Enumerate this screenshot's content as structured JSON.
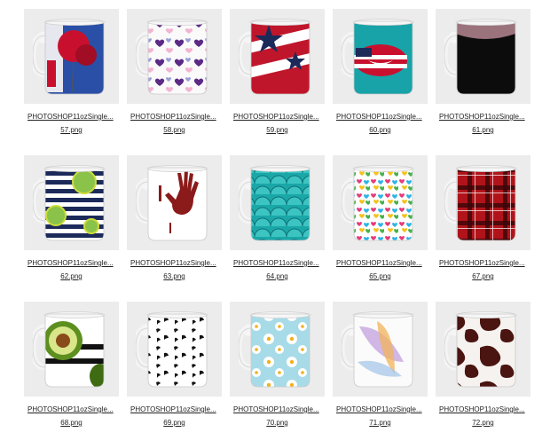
{
  "files": [
    {
      "name": "PHOTOSHOP11ozSingle...",
      "ext": "57.png",
      "design": "balloon-icon"
    },
    {
      "name": "PHOTOSHOP11ozSingle...",
      "ext": "58.png",
      "design": "hearts-icon"
    },
    {
      "name": "PHOTOSHOP11ozSingle...",
      "ext": "59.png",
      "design": "stars-stripes-icon"
    },
    {
      "name": "PHOTOSHOP11ozSingle...",
      "ext": "60.png",
      "design": "flag-lips-icon"
    },
    {
      "name": "PHOTOSHOP11ozSingle...",
      "ext": "61.png",
      "design": "black-sparkle-icon"
    },
    {
      "name": "PHOTOSHOP11ozSingle...",
      "ext": "62.png",
      "design": "lime-stripes-icon"
    },
    {
      "name": "PHOTOSHOP11ozSingle...",
      "ext": "63.png",
      "design": "handprint-icon"
    },
    {
      "name": "PHOTOSHOP11ozSingle...",
      "ext": "64.png",
      "design": "mermaid-scales-icon"
    },
    {
      "name": "PHOTOSHOP11ozSingle...",
      "ext": "65.png",
      "design": "rainbow-hearts-icon"
    },
    {
      "name": "PHOTOSHOP11ozSingle...",
      "ext": "67.png",
      "design": "red-plaid-icon"
    },
    {
      "name": "PHOTOSHOP11ozSingle...",
      "ext": "68.png",
      "design": "avocado-icon"
    },
    {
      "name": "PHOTOSHOP11ozSingle...",
      "ext": "69.png",
      "design": "leopard-icon"
    },
    {
      "name": "PHOTOSHOP11ozSingle...",
      "ext": "70.png",
      "design": "daisy-icon"
    },
    {
      "name": "PHOTOSHOP11ozSingle...",
      "ext": "71.png",
      "design": "watercolor-feathers-icon"
    },
    {
      "name": "PHOTOSHOP11ozSingle...",
      "ext": "72.png",
      "design": "cowhide-icon"
    }
  ]
}
